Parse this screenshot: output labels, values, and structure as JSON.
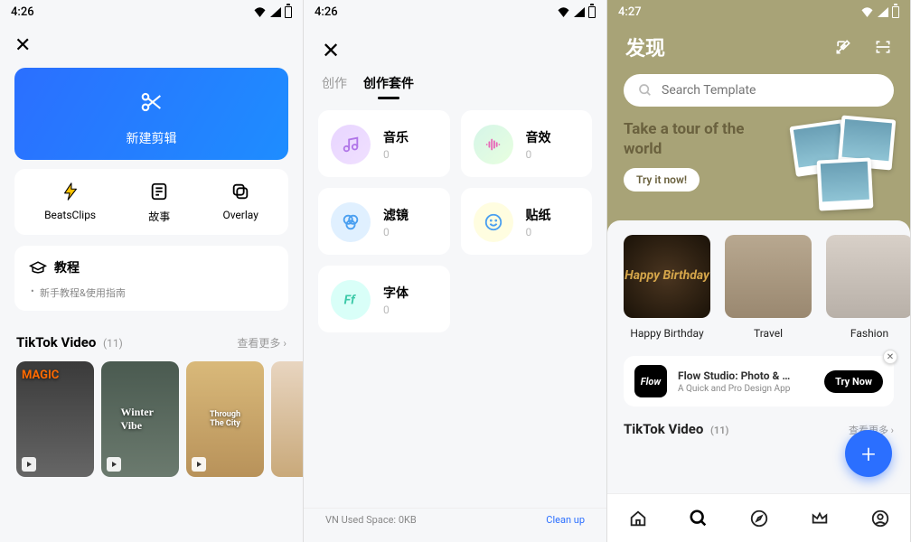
{
  "s1": {
    "time": "4:26",
    "new_edit": "新建剪辑",
    "features": [
      {
        "label": "BeatsClips"
      },
      {
        "label": "故事"
      },
      {
        "label": "Overlay"
      }
    ],
    "tutorial": {
      "title": "教程",
      "sub": "新手教程&使用指南"
    },
    "tiktok": {
      "title": "TikTok Video",
      "count": "(11)",
      "more": "查看更多"
    },
    "thumbs": [
      {
        "title": "MAGIC"
      },
      {
        "title": "Winter Vibe"
      },
      {
        "title": "Through The City"
      },
      {
        "title": ""
      }
    ]
  },
  "s2": {
    "time": "4:26",
    "tabs": {
      "create": "创作",
      "kit": "创作套件"
    },
    "cards": {
      "music": {
        "name": "音乐",
        "count": "0"
      },
      "sfx": {
        "name": "音效",
        "count": "0"
      },
      "filter": {
        "name": "滤镜",
        "count": "0"
      },
      "sticker": {
        "name": "贴纸",
        "count": "0"
      },
      "font": {
        "name": "字体",
        "count": "0"
      }
    },
    "footer": {
      "used": "VN Used Space: 0KB",
      "cleanup": "Clean up"
    }
  },
  "s3": {
    "time": "4:27",
    "title": "发现",
    "search_placeholder": "Search Template",
    "banner": {
      "line1": "Take a tour of the",
      "line2": "world",
      "btn": "Try it now!"
    },
    "cats": [
      {
        "label": "Happy Birthday",
        "img_text": "Happy Birthday"
      },
      {
        "label": "Travel"
      },
      {
        "label": "Fashion"
      }
    ],
    "ad": {
      "logo": "Flow",
      "title": "Flow Studio: Photo & …",
      "sub": "A Quick and Pro Design App",
      "try": "Try Now"
    },
    "tiktok": {
      "title": "TikTok Video",
      "count": "(11)",
      "more": "查看更多"
    }
  }
}
